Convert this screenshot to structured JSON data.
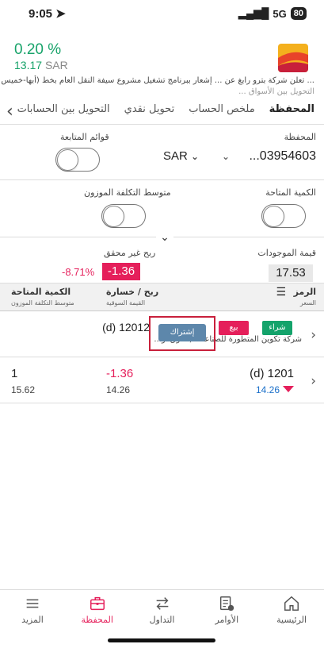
{
  "status": {
    "time": "9:05",
    "network": "5G",
    "battery": "80"
  },
  "header": {
    "change_pct": "0.20 %",
    "price": "13.17",
    "currency": "SAR"
  },
  "ticker": {
    "line1": "... تعلن شركة بترو رابغ عن ... إشعار ببرنامج تشغيل مشروع سيفة النقل العام بخط (أبها-خميس مشيط-أحد رفيدة)",
    "line2": "التحويل بين الأسواق ..."
  },
  "tabs": {
    "portfolio": "المحفظة",
    "account_summary": "ملخص الحساب",
    "cash_transfer": "تحويل نقدي",
    "market_transfer": "التحويل بين الحسابات"
  },
  "portfolio": {
    "account_label": "المحفظة",
    "account_number": "...03954603",
    "currency": "SAR",
    "watchlists_label": "قوائم المتابعة",
    "available_qty_label": "الكمية المتاحة",
    "avg_cost_label": "متوسط التكلفة الموزون"
  },
  "summary": {
    "holdings_value_label": "قيمة الموجودات",
    "holdings_value": "17.53",
    "unrealized_label": "ربح غير محقق",
    "unrealized_value": "-1.36",
    "unrealized_pct": "-8.71%"
  },
  "table": {
    "col_symbol": "الرمز",
    "col_symbol_sub": "السعر",
    "col_pl": "ربح / خسارة",
    "col_pl_sub": "القيمة السوقية",
    "col_qty": "الكمية المتاحة",
    "col_qty_sub": "متوسط التكلفة الموزون"
  },
  "expanded_row": {
    "symbol": "(d) 12012",
    "company": "شركة تكوين المتطورة للصناعات (حقوق أو...",
    "buy_label": "شراء",
    "sell_label": "بيع",
    "subscribe_label": "إشتراك"
  },
  "holding_row": {
    "symbol": "(d) 1201",
    "price": "14.26",
    "pl": "-1.36",
    "market_value": "14.26",
    "qty": "1",
    "avg_cost": "15.62"
  },
  "nav": {
    "home": "الرئيسية",
    "orders": "الأوامر",
    "trading": "التداول",
    "portfolio": "المحفظة",
    "more": "المزيد"
  },
  "colors": {
    "green": "#18a36a",
    "red": "#e51f5b",
    "subscribe": "#5d87ab"
  }
}
